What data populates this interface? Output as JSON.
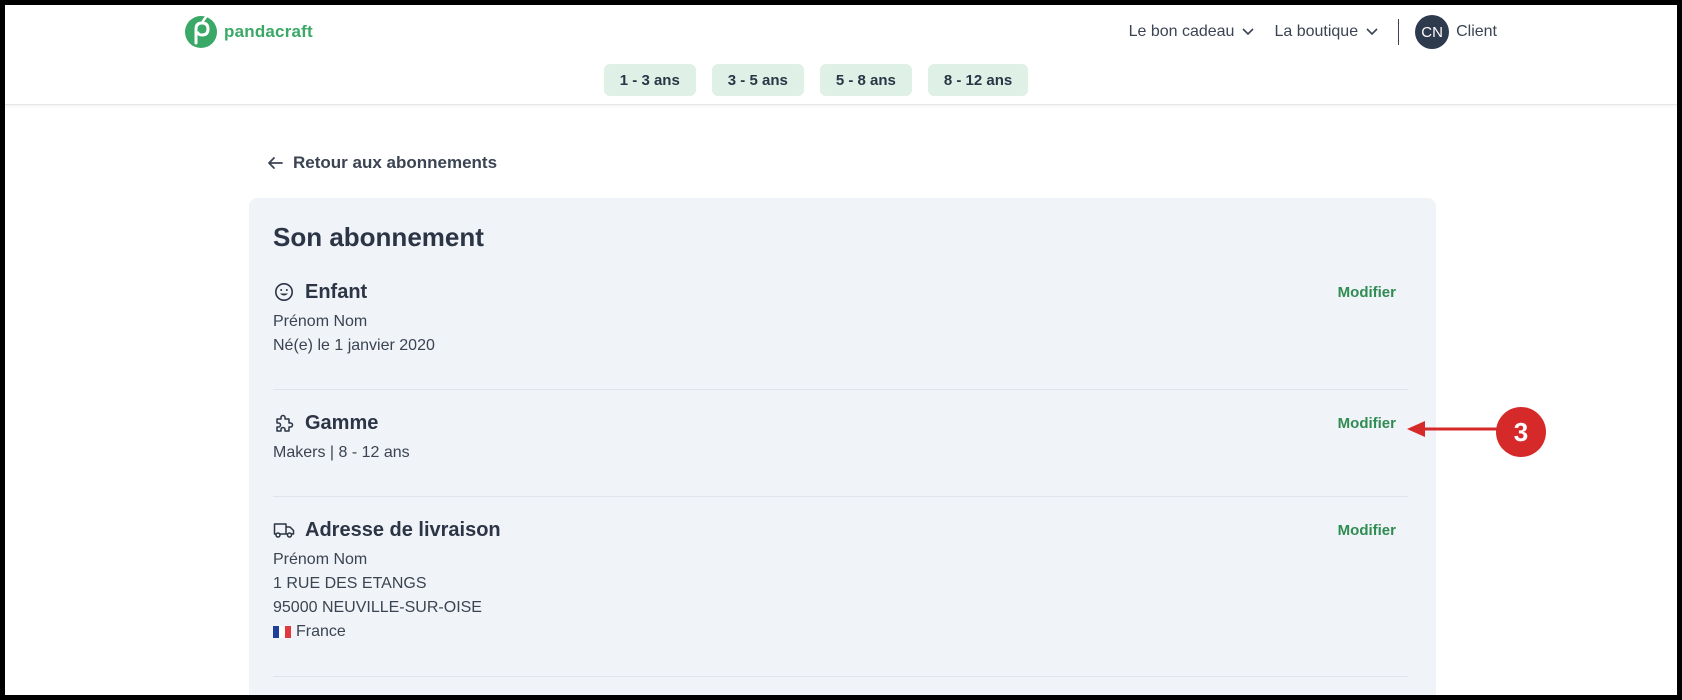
{
  "header": {
    "brand": "pandacraft",
    "nav": [
      {
        "label": "Le bon cadeau"
      },
      {
        "label": "La boutique"
      }
    ],
    "user": {
      "initials": "CN",
      "label": "Client"
    },
    "age_tabs": [
      "1 - 3 ans",
      "3 - 5 ans",
      "5 - 8 ans",
      "8 - 12 ans"
    ]
  },
  "back_link": "Retour aux abonnements",
  "card": {
    "title": "Son abonnement",
    "sections": [
      {
        "icon": "smiley-icon",
        "title": "Enfant",
        "action": "Modifier",
        "lines": [
          "Prénom Nom",
          "Né(e) le 1 janvier 2020"
        ]
      },
      {
        "icon": "puzzle-icon",
        "title": "Gamme",
        "action": "Modifier",
        "lines": [
          "Makers | 8 - 12 ans"
        ]
      },
      {
        "icon": "truck-icon",
        "title": "Adresse de livraison",
        "action": "Modifier",
        "lines": [
          "Prénom Nom",
          "1 RUE DES ETANGS",
          "95000 NEUVILLE-SUR-OISE",
          "France"
        ]
      }
    ]
  },
  "annotation": {
    "number": "3"
  },
  "colors": {
    "brand_green": "#3aa866",
    "action_green": "#2f8c52",
    "tab_bg": "#dff1e6",
    "card_bg": "#f0f3f7",
    "annotation_red": "#d62a2a"
  }
}
